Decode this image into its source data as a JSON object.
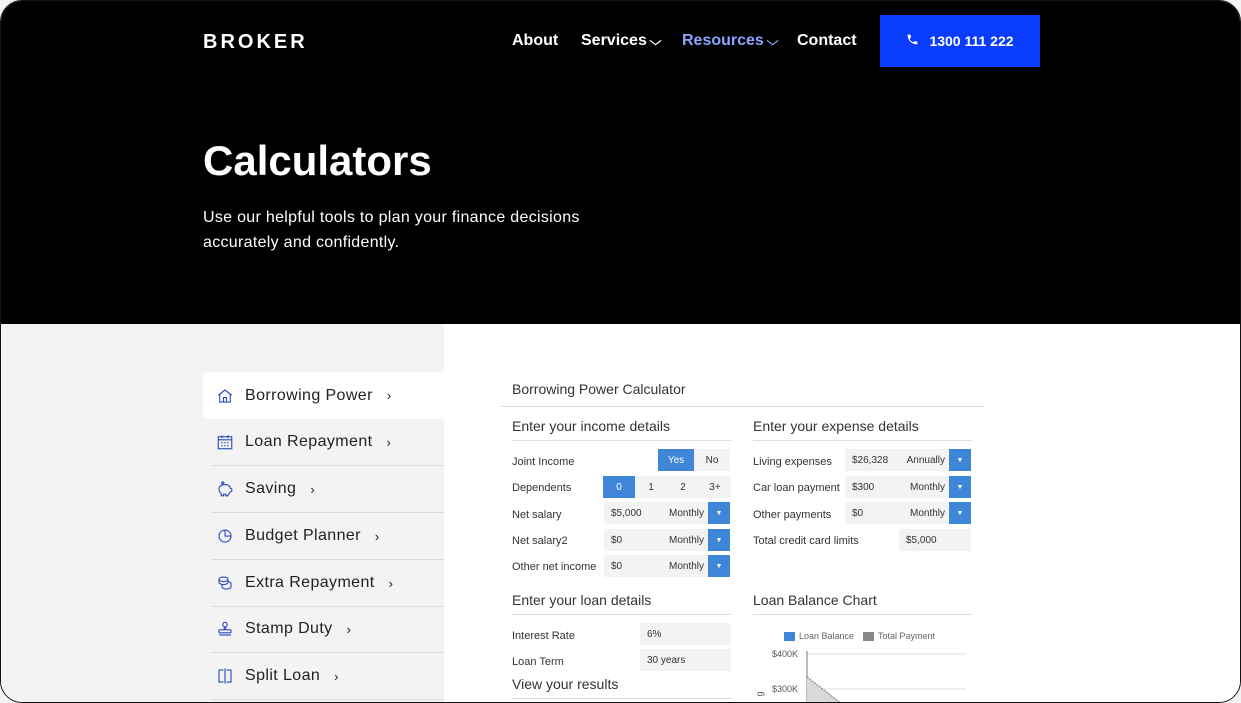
{
  "header": {
    "logo": "BROKER",
    "nav": [
      {
        "label": "About"
      },
      {
        "label": "Services",
        "chevron": "⌄"
      },
      {
        "label": "Resources",
        "chevron": "⌄"
      },
      {
        "label": "Contact"
      }
    ],
    "phone": "1300 111 222",
    "accent_color": "#0a3cff",
    "active_nav_color": "#8aa4ff"
  },
  "hero": {
    "title": "Calculators",
    "subtitle": "Use our helpful tools to plan your finance decisions accurately and confidently."
  },
  "sidebar": {
    "items": [
      {
        "label": "Borrowing Power",
        "icon": "house-icon",
        "active": true
      },
      {
        "label": "Loan Repayment",
        "icon": "calendar-icon"
      },
      {
        "label": "Saving",
        "icon": "piggy-bank-icon"
      },
      {
        "label": "Budget Planner",
        "icon": "pie-chart-icon"
      },
      {
        "label": "Extra Repayment",
        "icon": "coins-icon"
      },
      {
        "label": "Stamp Duty",
        "icon": "stamp-icon"
      },
      {
        "label": "Split Loan",
        "icon": "split-icon"
      }
    ],
    "arrow": "›"
  },
  "calculator": {
    "title": "Borrowing Power Calculator",
    "income": {
      "title": "Enter your income details",
      "joint_label": "Joint Income",
      "joint_options": [
        "Yes",
        "No"
      ],
      "dependents_label": "Dependents",
      "dependents_options": [
        "0",
        "1",
        "2",
        "3+"
      ],
      "net_salary_label": "Net salary",
      "net_salary_value": "$5,000",
      "net_salary_freq": "Monthly",
      "net_salary2_label": "Net salary2",
      "net_salary2_value": "$0",
      "net_salary2_freq": "Monthly",
      "other_label": "Other net income",
      "other_value": "$0",
      "other_freq": "Monthly"
    },
    "expense": {
      "title": "Enter your expense details",
      "living_label": "Living expenses",
      "living_value": "$26,328",
      "living_freq": "Annually",
      "car_label": "Car loan payment",
      "car_value": "$300",
      "car_freq": "Monthly",
      "other_label": "Other payments",
      "other_value": "$0",
      "other_freq": "Monthly",
      "credit_label": "Total credit card limits",
      "credit_value": "$5,000"
    },
    "loan": {
      "title": "Enter your loan details",
      "rate_label": "Interest Rate",
      "rate_value": "6%",
      "term_label": "Loan Term",
      "term_value": "30 years"
    },
    "results_title": "View your results",
    "chart_title": "Loan Balance Chart",
    "dropdown_icon": "▼"
  },
  "chart_data": {
    "type": "area",
    "series": [
      {
        "name": "Loan Balance",
        "color": "#3f86d8",
        "values": []
      },
      {
        "name": "Total Payment",
        "color": "#888888",
        "values": []
      }
    ],
    "y_ticks": [
      "$400K",
      "$300K"
    ],
    "ylabel": "g",
    "legend": "top"
  }
}
